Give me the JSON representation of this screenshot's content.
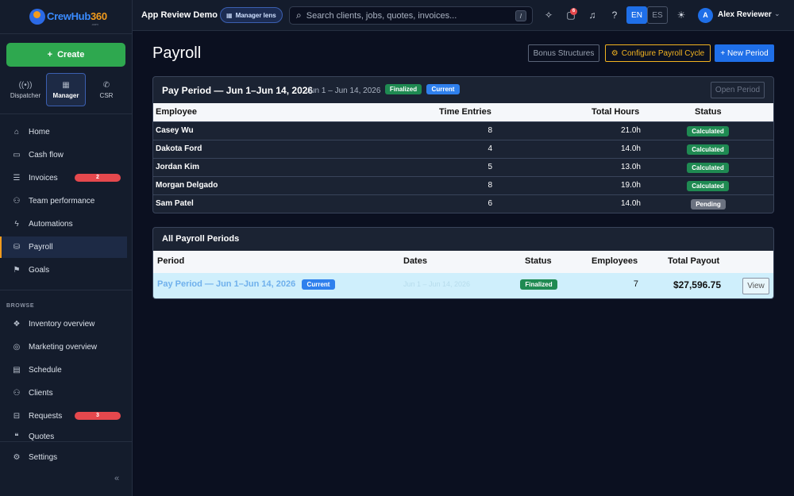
{
  "brand": {
    "logo_main": "CrewHub",
    "logo_num": "360",
    "logo_sub": ".com"
  },
  "create_label": "Create",
  "lenses": [
    {
      "label": "Dispatcher",
      "icon": "radio-icon"
    },
    {
      "label": "Manager",
      "icon": "building-icon"
    },
    {
      "label": "CSR",
      "icon": "phone-icon"
    }
  ],
  "nav": [
    {
      "label": "Home",
      "icon": "home-icon"
    },
    {
      "label": "Cash flow",
      "icon": "cash-icon"
    },
    {
      "label": "Invoices",
      "icon": "invoice-icon",
      "badge": "2"
    },
    {
      "label": "Team performance",
      "icon": "team-icon"
    },
    {
      "label": "Automations",
      "icon": "bolt-icon"
    },
    {
      "label": "Payroll",
      "icon": "payroll-icon",
      "active": true
    },
    {
      "label": "Goals",
      "icon": "goals-icon"
    }
  ],
  "browse_label": "BROWSE",
  "browse": [
    {
      "label": "Inventory overview",
      "icon": "inventory-icon"
    },
    {
      "label": "Marketing overview",
      "icon": "target-icon"
    },
    {
      "label": "Schedule",
      "icon": "calendar-icon"
    },
    {
      "label": "Clients",
      "icon": "clients-icon"
    },
    {
      "label": "Requests",
      "icon": "inbox-icon",
      "badge": "3"
    },
    {
      "label": "Quotes",
      "icon": "quote-icon"
    }
  ],
  "settings_label": "Settings",
  "topbar": {
    "app_title": "App Review Demo",
    "lens_badge": "Manager lens",
    "search_placeholder": "Search clients, jobs, quotes, invoices...",
    "search_kbd": "/",
    "messages_count": "6",
    "lang_en": "EN",
    "lang_es": "ES",
    "user_initial": "A",
    "user_name": "Alex Reviewer"
  },
  "page": {
    "title": "Payroll",
    "bonus_button": "Bonus Structures",
    "config_button": "Configure Payroll Cycle",
    "new_button": "+ New Period"
  },
  "period": {
    "title": "Pay Period — Jun 1–Jun 14, 2026",
    "dates": "Jun 1 – Jun 14, 2026",
    "finalized": "Finalized",
    "current": "Current",
    "open_button": "Open Period",
    "headers": [
      "Employee",
      "Time Entries",
      "Total Hours",
      "Status"
    ],
    "rows": [
      {
        "name": "Casey Wu",
        "entries": "8",
        "hours": "21.0h",
        "status": "Calculated"
      },
      {
        "name": "Dakota Ford",
        "entries": "4",
        "hours": "14.0h",
        "status": "Calculated"
      },
      {
        "name": "Jordan Kim",
        "entries": "5",
        "hours": "13.0h",
        "status": "Calculated"
      },
      {
        "name": "Morgan Delgado",
        "entries": "8",
        "hours": "19.0h",
        "status": "Calculated"
      },
      {
        "name": "Sam Patel",
        "entries": "6",
        "hours": "14.0h",
        "status": "Pending"
      }
    ]
  },
  "all_periods": {
    "title": "All Payroll Periods",
    "headers": [
      "Period",
      "Dates",
      "Status",
      "Employees",
      "Total Payout"
    ],
    "row": {
      "period": "Pay Period — Jun 1–Jun 14, 2026",
      "current": "Current",
      "dates": "Jun 1 – Jun 14, 2026",
      "status": "Finalized",
      "employees": "7",
      "payout": "$27,596.75",
      "view": "View"
    }
  }
}
